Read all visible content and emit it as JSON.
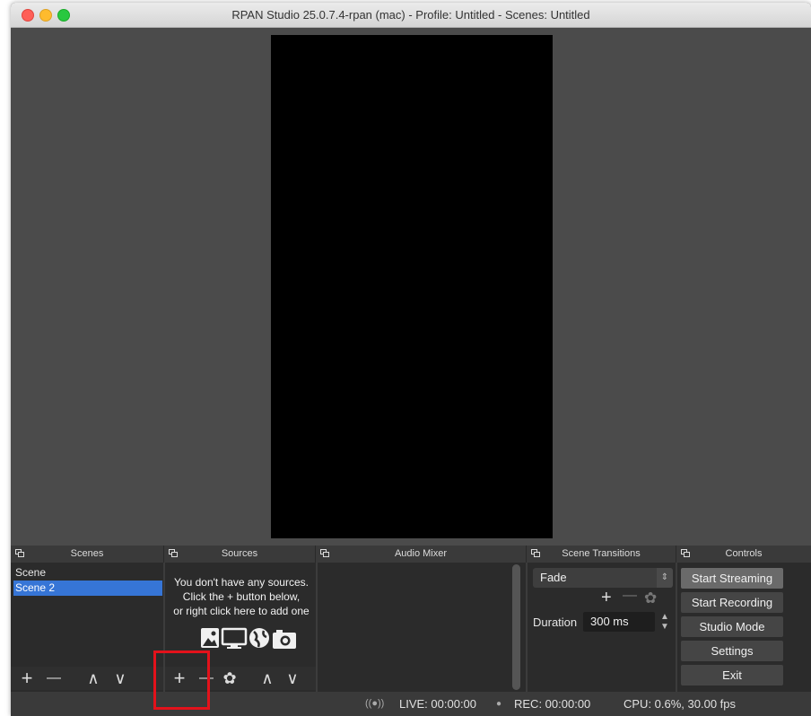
{
  "window": {
    "title": "RPAN Studio 25.0.7.4-rpan (mac) - Profile: Untitled - Scenes: Untitled"
  },
  "docks": {
    "scenes_title": "Scenes",
    "sources_title": "Sources",
    "mixer_title": "Audio Mixer",
    "transitions_title": "Scene Transitions",
    "controls_title": "Controls"
  },
  "scenes": {
    "items": [
      {
        "label": "Scene",
        "selected": false
      },
      {
        "label": "Scene 2",
        "selected": true
      }
    ],
    "toolbar": {
      "add": "+",
      "remove": "—",
      "up": "∧",
      "down": "∨"
    }
  },
  "sources": {
    "empty_line1": "You don't have any sources.",
    "empty_line2": "Click the + button below,",
    "empty_line3": "or right click here to add one",
    "toolbar": {
      "add": "+",
      "remove": "—",
      "settings": "✿",
      "up": "∧",
      "down": "∨"
    }
  },
  "transitions": {
    "selected": "Fade",
    "add": "+",
    "remove": "—",
    "duration_label": "Duration",
    "duration_value": "300 ms"
  },
  "controls": {
    "start_streaming": "Start Streaming",
    "start_recording": "Start Recording",
    "studio_mode": "Studio Mode",
    "settings": "Settings",
    "exit": "Exit"
  },
  "status": {
    "live": "LIVE: 00:00:00",
    "rec": "REC: 00:00:00",
    "cpu": "CPU: 0.6%, 30.00 fps"
  },
  "colors": {
    "accent_selected": "#3675d6",
    "highlight_box": "#e3121b"
  }
}
